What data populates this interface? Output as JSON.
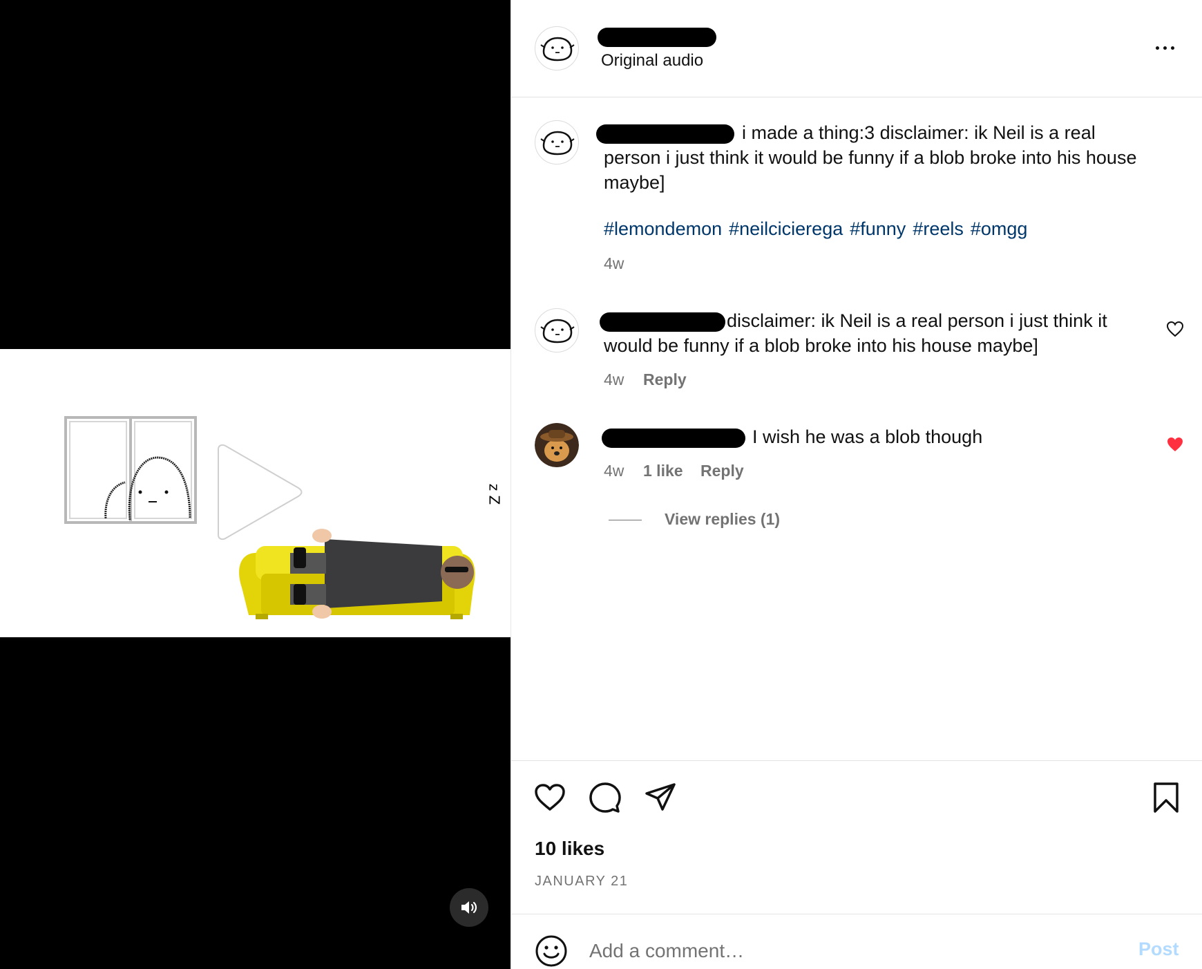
{
  "video": {
    "mute_icon": "speaker-icon",
    "sleep_text": "z Z"
  },
  "header": {
    "audio_label": "Original audio",
    "more_icon": "more-horizontal-icon"
  },
  "caption": {
    "text": "i made a thing:3 disclaimer: ik Neil is a real person i just think it would be funny if a blob broke into his house maybe]",
    "hashtags": [
      "#lemondemon",
      "#neilcicierega",
      "#funny",
      "#reels",
      "#omgg"
    ],
    "time": "4w"
  },
  "comments": [
    {
      "text": "disclaimer: ik Neil is a real person i just think it would be funny if a blob broke into his house maybe]",
      "time": "4w",
      "reply_label": "Reply",
      "liked": false
    },
    {
      "text": "I wish he was a blob though",
      "time": "4w",
      "likes_label": "1 like",
      "reply_label": "Reply",
      "liked": true,
      "view_replies": "View replies (1)"
    }
  ],
  "actions": {
    "likes": "10 likes",
    "date": "JANUARY 21"
  },
  "add_comment": {
    "placeholder": "Add a comment…",
    "post_label": "Post"
  },
  "colors": {
    "hashtag": "#00376b",
    "secondary": "#737373",
    "liked_heart": "#ff3040",
    "post_disabled": "#b3dbff"
  }
}
